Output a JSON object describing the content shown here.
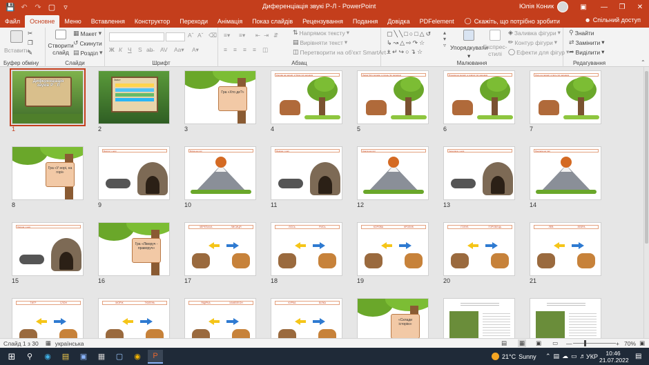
{
  "titlebar": {
    "title": "Диференціація звукі Р-Л  -  PowerPoint",
    "user": "Юлія Коник"
  },
  "tabs": [
    "Файл",
    "Основне",
    "Меню",
    "Вставлення",
    "Конструктор",
    "Переходи",
    "Анімація",
    "Показ слайдів",
    "Рецензування",
    "Подання",
    "Довідка",
    "PDFelement"
  ],
  "tabs_active": "Основне",
  "tell_me": "Скажіть, що потрібно зробити",
  "share": "Спільний доступ",
  "ribbon": {
    "clipboard": {
      "paste": "Вставити",
      "label": "Буфер обміну"
    },
    "slides": {
      "new_slide": "Створити слайд",
      "layout": "Макет",
      "reset": "Скинути",
      "section": "Розділ",
      "label": "Слайди"
    },
    "font": {
      "label": "Шрифт"
    },
    "paragraph": {
      "direction": "Напрямок тексту",
      "align": "Вирівняти текст",
      "smartart": "Перетворити на об'єкт SmartArt",
      "label": "Абзац"
    },
    "drawing": {
      "arrange": "Упорядкувати",
      "quick_styles": "Експрес-стилі",
      "fill": "Заливка фігури",
      "outline": "Контур фігури",
      "effects": "Ефекти для фігур",
      "label": "Малювання"
    },
    "editing": {
      "find": "Знайти",
      "replace": "Замінити",
      "select": "Виділити",
      "label": "Редагування"
    }
  },
  "slides": [
    {
      "n": "1",
      "type": "title",
      "title": "Диференціація звуків Р - Л"
    },
    {
      "n": "2",
      "type": "menu",
      "title": "Зміст"
    },
    {
      "n": "3",
      "type": "sign",
      "text": "Гра «Хто де?»"
    },
    {
      "n": "4",
      "type": "tree",
      "header": "Корова на дереві, а білка під деревом"
    },
    {
      "n": "5",
      "type": "tree",
      "header": "Ласка біля дерева, а олень під деревом"
    },
    {
      "n": "6",
      "type": "tree",
      "header": "Пташка на дереві, а ховрах під деревом"
    },
    {
      "n": "7",
      "type": "tree",
      "header": "Лось на дереві, а рись під деревом"
    },
    {
      "n": "8",
      "type": "sign",
      "text": "Гра «У норі, на горі»"
    },
    {
      "n": "9",
      "type": "burrow",
      "header": "Борсук у норі"
    },
    {
      "n": "10",
      "type": "mountain",
      "header": "Білка на горі"
    },
    {
      "n": "11",
      "type": "burrow",
      "header": "Ящірка у норі"
    },
    {
      "n": "12",
      "type": "mountain",
      "header": "Коала на горі"
    },
    {
      "n": "13",
      "type": "burrow",
      "header": "Черепаха у норі"
    },
    {
      "n": "14",
      "type": "mountain",
      "header": "Пантера на горі"
    },
    {
      "n": "15",
      "type": "burrow",
      "header": "Лисиця у норі"
    },
    {
      "n": "16",
      "type": "sign",
      "text": "Гра «Ліворуч - праворуч»"
    },
    {
      "n": "17",
      "type": "arrows",
      "left": "ЧЕРЕПАХА",
      "right": "ЛИСИЦЯ"
    },
    {
      "n": "18",
      "type": "arrows",
      "left": "ЛОСЬ",
      "right": "РИСЬ"
    },
    {
      "n": "19",
      "type": "arrows",
      "left": "КОРОВА",
      "right": "КРОЛИК"
    },
    {
      "n": "20",
      "type": "arrows",
      "left": "ГОЛУБ",
      "right": "ГОРОБЕЦЬ"
    },
    {
      "n": "21",
      "type": "arrows",
      "left": "ЛЕВ",
      "right": "ЗЕБРА"
    },
    {
      "n": "22",
      "type": "arrows",
      "left": "ТИГР",
      "right": "СЛОН"
    },
    {
      "n": "23",
      "type": "arrows",
      "left": "МОРЖ",
      "right": "ТЮЛЕНЬ"
    },
    {
      "n": "24",
      "type": "arrows",
      "left": "ЯЩІРКА",
      "right": "ХАМЕЛЕОН"
    },
    {
      "n": "25",
      "type": "arrows",
      "left": "КУРКА",
      "right": "БІЛКА"
    },
    {
      "n": "26",
      "type": "sign",
      "text": "«Склади історію»"
    },
    {
      "n": "27",
      "type": "story"
    },
    {
      "n": "28",
      "type": "story"
    }
  ],
  "status": {
    "slide": "Слайд 1 з 30",
    "language": "українська",
    "zoom": "70%"
  },
  "taskbar": {
    "weather_temp": "21°C",
    "weather_text": "Sunny",
    "lang": "УКР",
    "time": "10:46",
    "date": "21.07.2022"
  }
}
